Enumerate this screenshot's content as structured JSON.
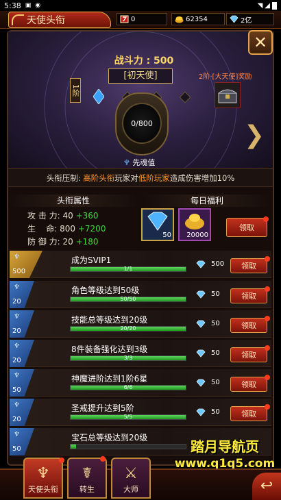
{
  "status": {
    "time": "5:38"
  },
  "header": {
    "title": "天使头衔",
    "resources": [
      {
        "icon": "ruby-icon",
        "value": "0"
      },
      {
        "icon": "gold-coins-icon",
        "value": "62354"
      },
      {
        "icon": "diamond-icon",
        "value": "2亿"
      }
    ]
  },
  "rank": {
    "power_label": "战斗力 : 500",
    "rank_name": "[初天使]",
    "tier": "1阶",
    "next_reward_label": "2阶·[大天使]奖励",
    "soul_progress": "0/800",
    "soul_label": "先魂值"
  },
  "suppress": {
    "prefix": "头衔压制: ",
    "hl1": "高阶头衔",
    "mid": "玩家对",
    "hl2": "低阶玩家",
    "suffix": "造成伤害增加10%"
  },
  "attributes": {
    "header": "头衔属性",
    "rows": [
      {
        "label": "攻 击 力: 40",
        "bonus": "+360"
      },
      {
        "label": "生    命: 800",
        "bonus": "+7200"
      },
      {
        "label": "防 御 力: 20",
        "bonus": "+180"
      }
    ]
  },
  "daily": {
    "header": "每日福利",
    "items": [
      {
        "icon": "diamond-pile-icon",
        "count": "50"
      },
      {
        "icon": "gold-bag-icon",
        "count": "20000"
      }
    ],
    "claim_label": "领取"
  },
  "tasks": [
    {
      "badge": "500",
      "name": "成为SVIP1",
      "progress": "1/1",
      "fraction": 1,
      "reward": "500",
      "claim": "领取"
    },
    {
      "badge": "20",
      "name": "角色等级达到50级",
      "progress": "50/50",
      "fraction": 1,
      "reward": "50",
      "claim": "领取"
    },
    {
      "badge": "20",
      "name": "技能总等级达到20级",
      "progress": "20/20",
      "fraction": 1,
      "reward": "50",
      "claim": "领取"
    },
    {
      "badge": "20",
      "name": "8件装备强化达到3级",
      "progress": "3/3",
      "fraction": 1,
      "reward": "50",
      "claim": "领取"
    },
    {
      "badge": "50",
      "name": "神魔进阶达到1阶6星",
      "progress": "6/6",
      "fraction": 1,
      "reward": "50",
      "claim": "领取"
    },
    {
      "badge": "20",
      "name": "圣戒提升达到5阶",
      "progress": "5/5",
      "fraction": 1,
      "reward": "50",
      "claim": "领取"
    },
    {
      "badge": "50",
      "name": "宝石总等级达到20级",
      "progress": "",
      "fraction": 0.05,
      "reward": "",
      "claim": ""
    }
  ],
  "watermark": {
    "cn": "踏月导航页",
    "url": "www.q1q5.com"
  },
  "bottom_tabs": [
    {
      "label": "天使头衔",
      "icon": "angel-wings-icon"
    },
    {
      "label": "转生",
      "icon": "rebirth-icon"
    },
    {
      "label": "大师",
      "icon": "master-icon"
    }
  ],
  "colors": {
    "accent_gold": "#ffd76a",
    "bonus_green": "#3ed83e",
    "highlight_orange": "#ff9a2e"
  }
}
